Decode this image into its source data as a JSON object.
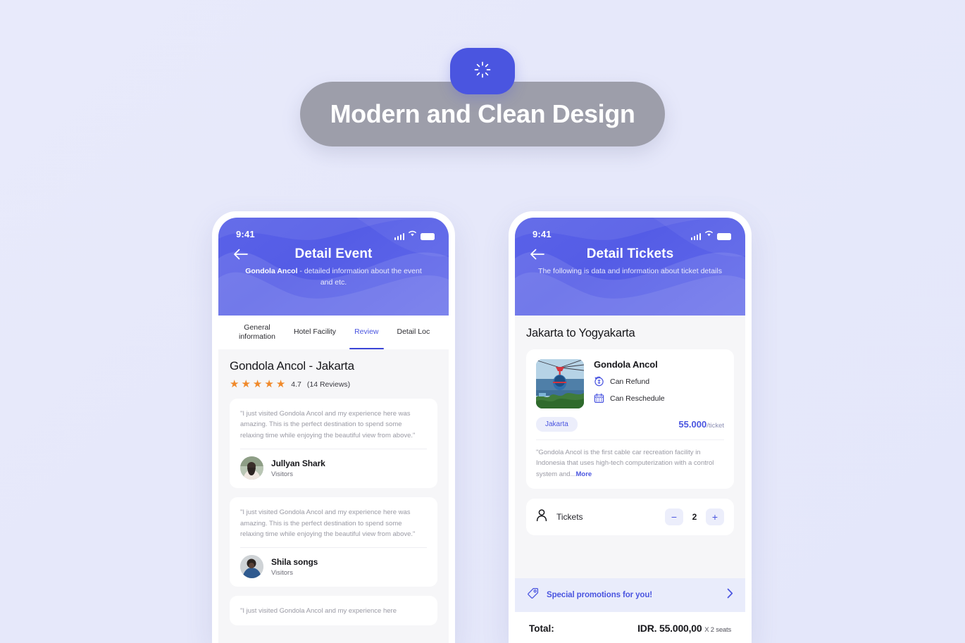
{
  "banner": {
    "headline": "Modern and Clean Design",
    "badge_icon": "loading-spinner-icon"
  },
  "phone_left": {
    "status_bar": {
      "time": "9:41",
      "signal_icon": "signal-bars-icon",
      "wifi_icon": "wifi-icon",
      "battery_icon": "battery-icon"
    },
    "header": {
      "back_icon": "back-arrow-icon",
      "title": "Detail Event",
      "subtitle_strong": "Gondola Ancol",
      "subtitle_rest": " - detailed information about the event and etc."
    },
    "tabs": [
      {
        "label": "General\ninformation",
        "active": false
      },
      {
        "label": "Hotel Facility",
        "active": false
      },
      {
        "label": "Review",
        "active": true
      },
      {
        "label": "Detail Loc",
        "active": false
      }
    ],
    "place_title": "Gondola Ancol - Jakarta",
    "rating": {
      "stars": 5,
      "score": "4.7",
      "count_text": "(14 Reviews)"
    },
    "reviews": [
      {
        "text": "\"I just visited Gondola Ancol and my experience here was amazing. This is the perfect destination to spend some relaxing time while enjoying the beautiful view from above.\"",
        "name": "Jullyan Shark",
        "role": "Visitors"
      },
      {
        "text": "\"I just visited Gondola Ancol and my experience here was amazing. This is the perfect destination to spend some relaxing time while enjoying the beautiful view from above.\"",
        "name": "Shila songs",
        "role": "Visitors"
      },
      {
        "text": "\"I just visited Gondola Ancol and my experience here",
        "name": "",
        "role": ""
      }
    ]
  },
  "phone_right": {
    "status_bar": {
      "time": "9:41",
      "signal_icon": "signal-bars-icon",
      "wifi_icon": "wifi-icon",
      "battery_icon": "battery-icon"
    },
    "header": {
      "back_icon": "back-arrow-icon",
      "title": "Detail Tickets",
      "subtitle": "The following is data and information about ticket details"
    },
    "route_title": "Jakarta to Yogyakarta",
    "ticket": {
      "name": "Gondola Ancol",
      "features": [
        {
          "icon": "refund-coin-icon",
          "label": "Can Refund"
        },
        {
          "icon": "calendar-reschedule-icon",
          "label": "Can Reschedule"
        }
      ],
      "city_chip": "Jakarta",
      "price": "55.000",
      "price_unit": "/ticket",
      "description": "\"Gondola Ancol is the first cable car recreation facility in Indonesia that uses high-tech computerization with a control system and...",
      "more_label": "More"
    },
    "tickets_row": {
      "icon": "person-icon",
      "label": "Tickets",
      "minus_label": "−",
      "value": "2",
      "plus_label": "+"
    },
    "promo": {
      "icon": "tag-icon",
      "label": "Special promotions for you!",
      "chevron_icon": "chevron-right-icon"
    },
    "total": {
      "label": "Total:",
      "amount": "IDR. 55.000,00",
      "seats": "X 2 seats"
    }
  },
  "colors": {
    "background": "#e6e8fa",
    "accent": "#4a55e0",
    "header_blue": "#5a62e8",
    "star_orange": "#f0892a",
    "chip_bg": "#eceefb",
    "promo_bg": "#e9ecfb"
  }
}
